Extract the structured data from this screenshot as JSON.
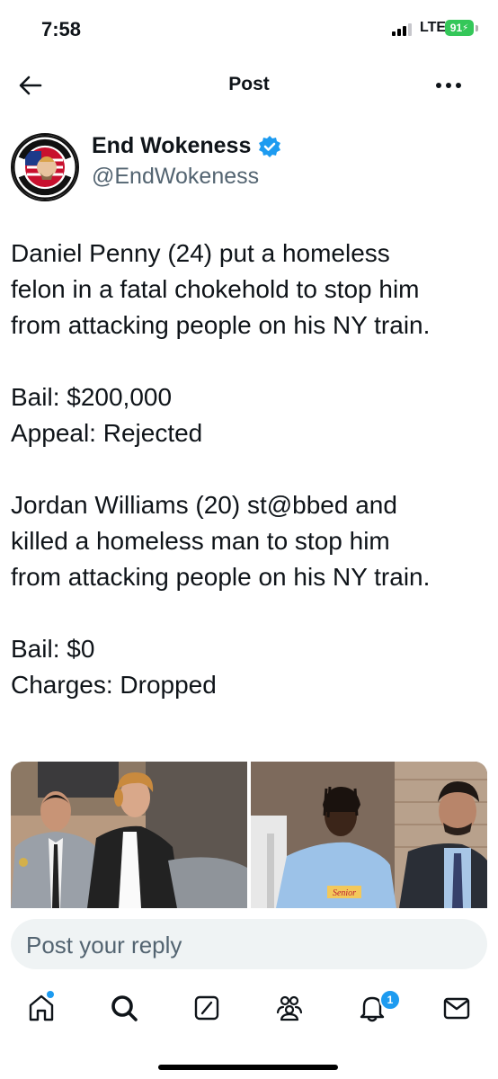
{
  "status_bar": {
    "time": "7:58",
    "network": "LTE",
    "battery": "91"
  },
  "nav": {
    "title": "Post"
  },
  "author": {
    "name": "End Wokeness",
    "handle": "@EndWokeness",
    "verified": true,
    "avatar_text": [
      "I SUPPORT THE",
      "FORMER THINGS"
    ]
  },
  "tweet": {
    "paragraphs": [
      [
        "Daniel Penny (24) put a homeless",
        "felon in a fatal chokehold to stop him",
        "from attacking people on his NY train."
      ],
      [
        "Bail: $200,000",
        "Appeal: Rejected"
      ],
      [
        "Jordan Williams (20) st@bbed and",
        "killed a homeless man to stop him",
        "from attacking people on his NY train."
      ],
      [
        "Bail: $0",
        "Charges: Dropped"
      ]
    ]
  },
  "media": {
    "photo2_shirt_text": "Senior"
  },
  "reply": {
    "placeholder": "Post your reply"
  },
  "tabs": [
    "home-icon",
    "search-icon",
    "grok-icon",
    "communities-icon",
    "notifications-icon",
    "messages-icon"
  ],
  "notifications": {
    "badge": "1"
  },
  "colors": {
    "accent": "#1d9bf0",
    "reply_bg": "#eff3f4",
    "secondary_text": "#536471",
    "battery": "#34c759"
  }
}
